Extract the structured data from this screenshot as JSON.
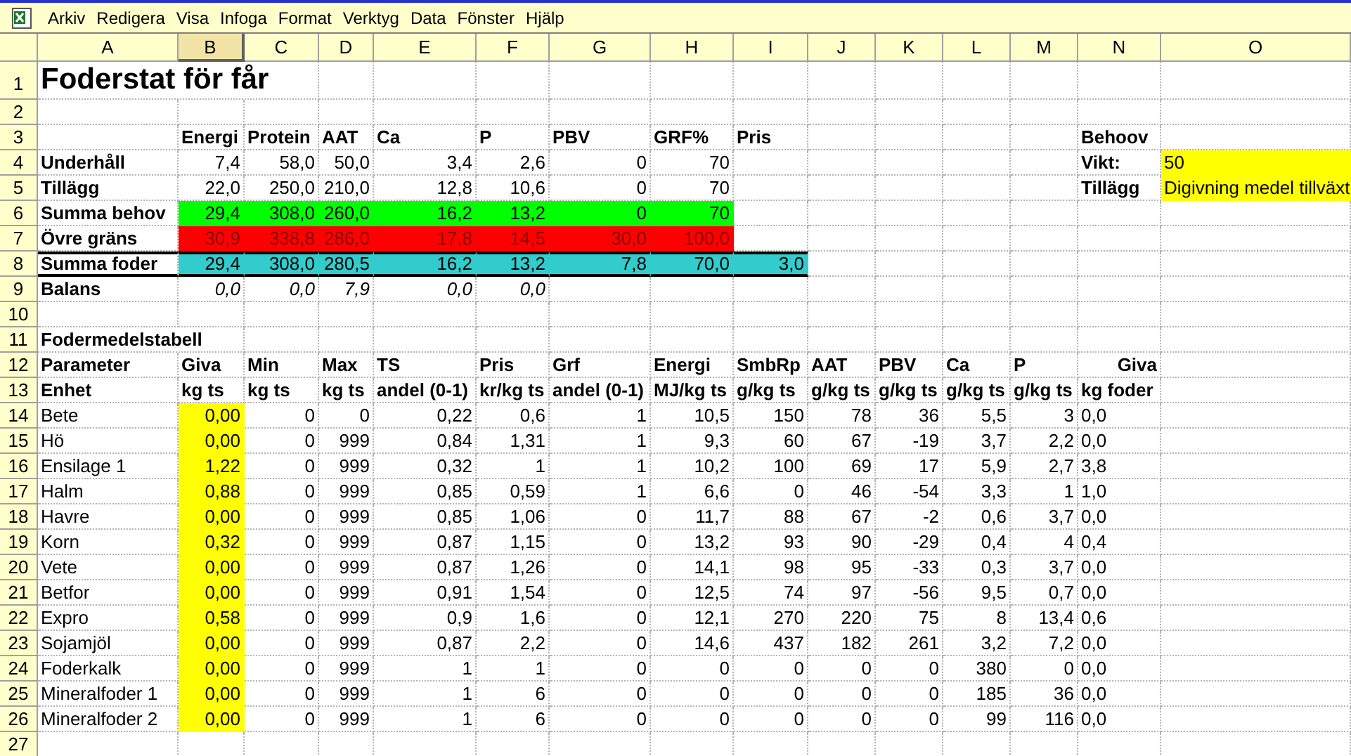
{
  "menu": [
    "Arkiv",
    "Redigera",
    "Visa",
    "Infoga",
    "Format",
    "Verktyg",
    "Data",
    "Fönster",
    "Hjälp"
  ],
  "columns": [
    {
      "label": "A",
      "selected": false
    },
    {
      "label": "B",
      "selected": true
    },
    {
      "label": "C",
      "selected": false
    },
    {
      "label": "D",
      "selected": false
    },
    {
      "label": "E",
      "selected": false
    },
    {
      "label": "F",
      "selected": false
    },
    {
      "label": "G",
      "selected": false
    },
    {
      "label": "H",
      "selected": false
    },
    {
      "label": "I",
      "selected": false
    },
    {
      "label": "J",
      "selected": false
    },
    {
      "label": "K",
      "selected": false
    },
    {
      "label": "L",
      "selected": false
    },
    {
      "label": "M",
      "selected": false
    },
    {
      "label": "N",
      "selected": false
    },
    {
      "label": "O",
      "selected": false
    }
  ],
  "rows": [
    {
      "n": "1",
      "kind": "title",
      "cells": [
        "Foderstat för får"
      ]
    },
    {
      "n": "2",
      "kind": "blank",
      "cells": []
    },
    {
      "n": "3",
      "kind": "header",
      "cells": [
        null,
        "Energi",
        "Protein",
        "AAT",
        "Ca",
        "P",
        "PBV",
        "GRF%",
        "Pris",
        null,
        null,
        null,
        null,
        "Behoov"
      ]
    },
    {
      "n": "4",
      "kind": "summary",
      "cells": [
        "Underhåll",
        "7,4",
        "58,0",
        "50,0",
        "3,4",
        "2,6",
        "0",
        "70",
        null,
        null,
        null,
        null,
        null,
        {
          "text": "Vikt:",
          "bold": true
        },
        {
          "text": "50",
          "color": "#ffff00"
        }
      ]
    },
    {
      "n": "5",
      "kind": "summary",
      "cells": [
        "Tillägg",
        "22,0",
        "250,0",
        "210,0",
        "12,8",
        "10,6",
        "0",
        "70",
        null,
        null,
        null,
        null,
        null,
        {
          "text": "Tillägg",
          "bold": true
        },
        {
          "text": "Digivning medel tillväxt",
          "color": "#ffff00"
        }
      ]
    },
    {
      "n": "6",
      "kind": "summary",
      "color": "#00ff00",
      "cells": [
        "Summa behov",
        "29,4",
        "308,0",
        "260,0",
        "16,2",
        "13,2",
        "0",
        "70"
      ]
    },
    {
      "n": "7",
      "kind": "limit",
      "color": "#ff0000",
      "cells": [
        "Övre gräns",
        "30,9",
        "338,8",
        "286,0",
        "17,8",
        "14,5",
        "30,0",
        "100,0"
      ]
    },
    {
      "n": "8",
      "kind": "total",
      "color": "#33cccc",
      "cells": [
        "Summa foder",
        "29,4",
        "308,0",
        "280,5",
        "16,2",
        "13,2",
        "7,8",
        "70,0",
        "3,0"
      ]
    },
    {
      "n": "9",
      "kind": "balance",
      "cells": [
        "Balans",
        "0,0",
        "0,0",
        "7,9",
        "0,0",
        "0,0"
      ]
    },
    {
      "n": "10",
      "kind": "blank",
      "cells": []
    },
    {
      "n": "11",
      "kind": "header",
      "cells": [
        "Fodermedelstabell"
      ]
    },
    {
      "n": "12",
      "kind": "header",
      "cells": [
        "Parameter",
        "Giva",
        "Min",
        "Max",
        "TS",
        "Pris",
        "Grf",
        "Energi",
        "SmbRp",
        "AAT",
        "PBV",
        "Ca",
        "P",
        {
          "text": "Giva",
          "right_aligned": true
        }
      ]
    },
    {
      "n": "13",
      "kind": "header",
      "cells": [
        "Enhet",
        "kg ts",
        "kg ts",
        "kg ts",
        "andel (0-1)",
        "kr/kg ts",
        "andel (0-1)",
        "MJ/kg ts",
        "g/kg ts",
        "g/kg ts",
        "g/kg ts",
        "g/kg ts",
        "g/kg ts",
        "kg foder"
      ]
    },
    {
      "n": "14",
      "kind": "item",
      "cells": [
        "Bete",
        {
          "text": "0,00",
          "color": "#ffff00"
        },
        "0",
        "0",
        "0,22",
        "0,6",
        "1",
        "10,5",
        "150",
        "78",
        "36",
        "5,5",
        "3",
        "0,0"
      ]
    },
    {
      "n": "15",
      "kind": "item",
      "cells": [
        "Hö",
        {
          "text": "0,00",
          "color": "#ffff00"
        },
        "0",
        "999",
        "0,84",
        "1,31",
        "1",
        "9,3",
        "60",
        "67",
        "-19",
        "3,7",
        "2,2",
        "0,0"
      ]
    },
    {
      "n": "16",
      "kind": "item",
      "cells": [
        "Ensilage 1",
        {
          "text": "1,22",
          "color": "#ffff00"
        },
        "0",
        "999",
        "0,32",
        "1",
        "1",
        "10,2",
        "100",
        "69",
        "17",
        "5,9",
        "2,7",
        "3,8"
      ]
    },
    {
      "n": "17",
      "kind": "item",
      "cells": [
        "Halm",
        {
          "text": "0,88",
          "color": "#ffff00"
        },
        "0",
        "999",
        "0,85",
        "0,59",
        "1",
        "6,6",
        "0",
        "46",
        "-54",
        "3,3",
        "1",
        "1,0"
      ]
    },
    {
      "n": "18",
      "kind": "item",
      "cells": [
        "Havre",
        {
          "text": "0,00",
          "color": "#ffff00"
        },
        "0",
        "999",
        "0,85",
        "1,06",
        "0",
        "11,7",
        "88",
        "67",
        "-2",
        "0,6",
        "3,7",
        "0,0"
      ]
    },
    {
      "n": "19",
      "kind": "item",
      "cells": [
        "Korn",
        {
          "text": "0,32",
          "color": "#ffff00"
        },
        "0",
        "999",
        "0,87",
        "1,15",
        "0",
        "13,2",
        "93",
        "90",
        "-29",
        "0,4",
        "4",
        "0,4"
      ]
    },
    {
      "n": "20",
      "kind": "item",
      "cells": [
        "Vete",
        {
          "text": "0,00",
          "color": "#ffff00"
        },
        "0",
        "999",
        "0,87",
        "1,26",
        "0",
        "14,1",
        "98",
        "95",
        "-33",
        "0,3",
        "3,7",
        "0,0"
      ]
    },
    {
      "n": "21",
      "kind": "item",
      "cells": [
        "Betfor",
        {
          "text": "0,00",
          "color": "#ffff00"
        },
        "0",
        "999",
        "0,91",
        "1,54",
        "0",
        "12,5",
        "74",
        "97",
        "-56",
        "9,5",
        "0,7",
        "0,0"
      ]
    },
    {
      "n": "22",
      "kind": "item",
      "cells": [
        "Expro",
        {
          "text": "0,58",
          "color": "#ffff00"
        },
        "0",
        "999",
        "0,9",
        "1,6",
        "0",
        "12,1",
        "270",
        "220",
        "75",
        "8",
        "13,4",
        "0,6"
      ]
    },
    {
      "n": "23",
      "kind": "item",
      "cells": [
        "Sojamjöl",
        {
          "text": "0,00",
          "color": "#ffff00"
        },
        "0",
        "999",
        "0,87",
        "2,2",
        "0",
        "14,6",
        "437",
        "182",
        "261",
        "3,2",
        "7,2",
        "0,0"
      ]
    },
    {
      "n": "24",
      "kind": "item",
      "cells": [
        "Foderkalk",
        {
          "text": "0,00",
          "color": "#ffff00"
        },
        "0",
        "999",
        "1",
        "1",
        "0",
        "0",
        "0",
        "0",
        "0",
        "380",
        "0",
        "0,0"
      ]
    },
    {
      "n": "25",
      "kind": "item",
      "cells": [
        "Mineralfoder 1",
        {
          "text": "0,00",
          "color": "#ffff00"
        },
        "0",
        "999",
        "1",
        "6",
        "0",
        "0",
        "0",
        "0",
        "0",
        "185",
        "36",
        "0,0"
      ]
    },
    {
      "n": "26",
      "kind": "item",
      "cells": [
        "Mineralfoder 2",
        {
          "text": "0,00",
          "color": "#ffff00"
        },
        "0",
        "999",
        "1",
        "6",
        "0",
        "0",
        "0",
        "0",
        "0",
        "99",
        "116",
        "0,0"
      ]
    },
    {
      "n": "27",
      "kind": "blank",
      "cells": []
    }
  ]
}
